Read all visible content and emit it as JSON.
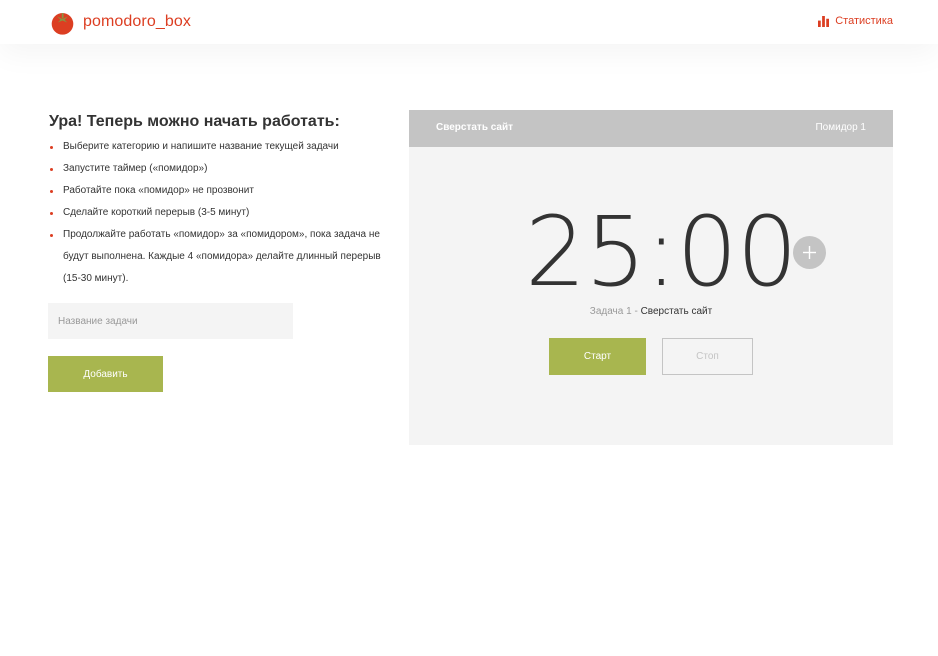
{
  "header": {
    "logo_text": "pomodoro_box",
    "logo_icon": "tomato-icon",
    "stats_label": "Статистика",
    "stats_icon": "bar-chart-icon"
  },
  "intro": {
    "title": "Ура! Теперь можно начать работать:",
    "items": [
      "Выберите категорию и напишите название текущей задачи",
      "Запустите таймер («помидор»)",
      "Работайте пока «помидор» не прозвонит",
      "Сделайте короткий перерыв (3-5 минут)",
      "Продолжайте работать «помидор» за «помидором», пока задача не будут выполнена. Каждые 4 «помидора» делайте длинный перерыв (15-30 минут)."
    ]
  },
  "task_form": {
    "input_value": "",
    "input_placeholder": "Название задачи",
    "add_button_label": "Добавить"
  },
  "timer": {
    "task_name": "Сверстать сайт",
    "pomodoro_label": "Помидор 1",
    "time": "25:00",
    "add_time_icon": "plus-icon",
    "caption_prefix": "Задача 1 - ",
    "caption_task": "Сверстать сайт",
    "start_label": "Старт",
    "stop_label": "Стоп"
  },
  "colors": {
    "accent_red": "#DC3E22",
    "accent_green": "#A8B64F",
    "panel_bg": "#F4F4F4",
    "panel_header": "#C4C4C4"
  }
}
